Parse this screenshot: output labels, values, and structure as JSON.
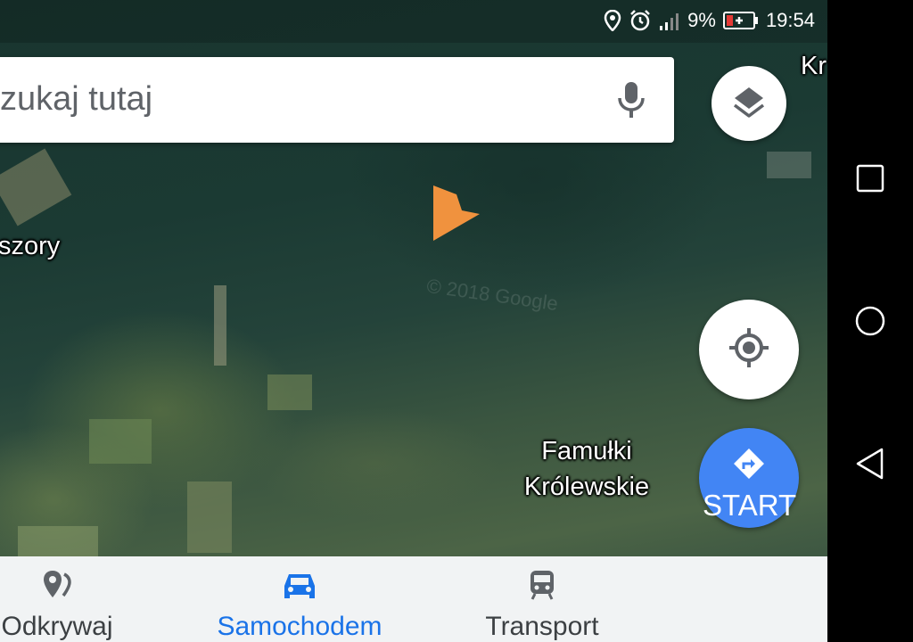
{
  "status_bar": {
    "battery_percent": "9%",
    "time": "19:54",
    "icons": [
      "location-icon",
      "alarm-icon",
      "signal-icon",
      "battery-icon"
    ]
  },
  "search": {
    "placeholder_visible": "zukaj tutaj"
  },
  "map": {
    "labels": {
      "left_town": "szory",
      "top_right_town": "Kr",
      "town_line1": "Famułki",
      "town_line2": "Królewskie"
    },
    "watermark": "© 2018 Google",
    "marker_color": "#f0923e"
  },
  "buttons": {
    "layers_icon": "layers-icon",
    "locate_icon": "my-location-icon",
    "start_label": "START"
  },
  "bottom_nav": {
    "tabs": [
      {
        "label": "Odkrywaj",
        "icon": "explore-pin-icon",
        "active": false
      },
      {
        "label": "Samochodem",
        "icon": "car-icon",
        "active": true
      },
      {
        "label": "Transport",
        "icon": "train-icon",
        "active": false
      }
    ]
  },
  "colors": {
    "accent": "#1a73e8",
    "start_fab": "#4285f4"
  }
}
